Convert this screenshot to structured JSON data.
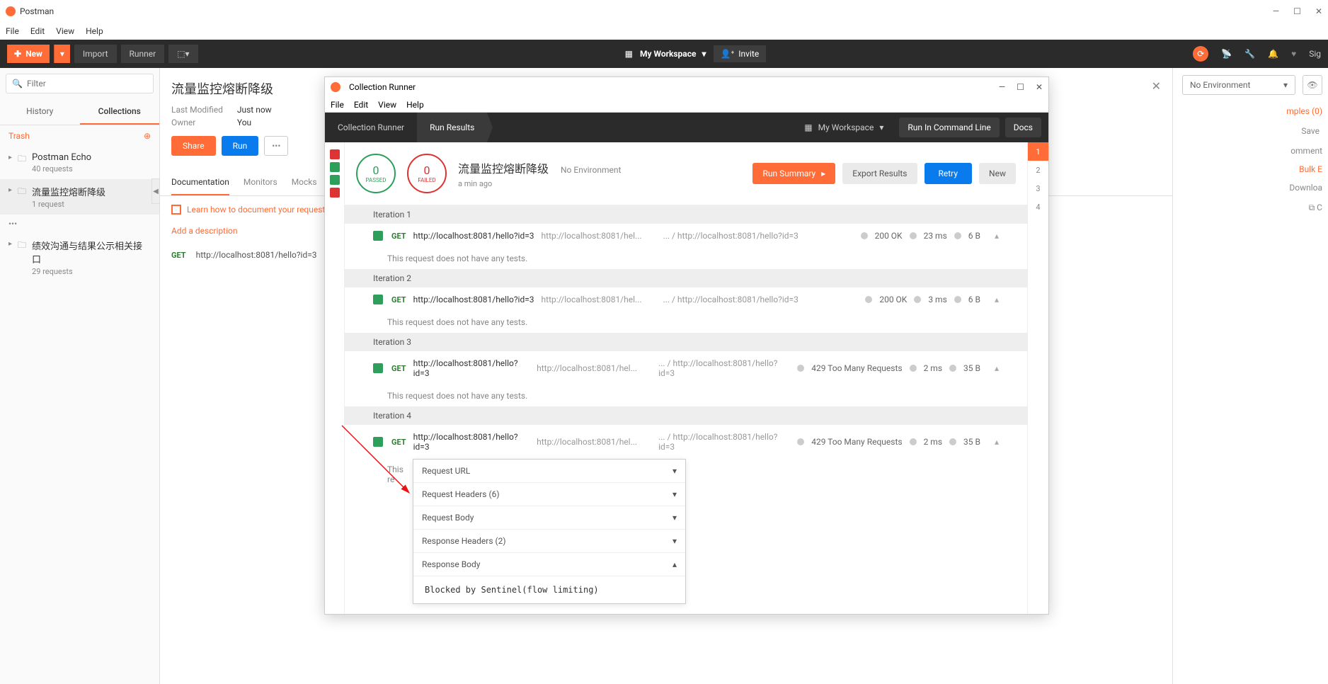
{
  "app": {
    "title": "Postman"
  },
  "menu": {
    "file": "File",
    "edit": "Edit",
    "view": "View",
    "help": "Help"
  },
  "toolbar": {
    "new": "New",
    "import": "Import",
    "runner": "Runner",
    "workspace": "My Workspace",
    "invite": "Invite",
    "signin": "Sig"
  },
  "sidebar": {
    "filter_placeholder": "Filter",
    "tab_history": "History",
    "tab_collections": "Collections",
    "trash": "Trash",
    "collections": [
      {
        "name": "Postman Echo",
        "sub": "40 requests"
      },
      {
        "name": "流量监控熔断降级",
        "sub": "1 request"
      },
      {
        "name": "绩效沟通与结果公示相关接口",
        "sub": "29 requests"
      }
    ]
  },
  "doc": {
    "title": "流量监控熔断降级",
    "last_mod_label": "Last Modified",
    "last_mod_val": "Just now",
    "owner_label": "Owner",
    "owner_val": "You",
    "share": "Share",
    "run": "Run",
    "tab_doc": "Documentation",
    "tab_mon": "Monitors",
    "tab_mock": "Mocks",
    "learn": "Learn how to document your requests",
    "add_desc": "Add a description",
    "method": "GET",
    "url": "http://localhost:8081/hello?id=3"
  },
  "env": {
    "none": "No Environment"
  },
  "rightbar": {
    "examples": "mples (0)",
    "save": "Save",
    "comments": "omment",
    "bulk": "Bulk E",
    "download": "Downloa"
  },
  "runner": {
    "title": "Collection Runner",
    "menu": {
      "file": "File",
      "edit": "Edit",
      "view": "View",
      "help": "Help"
    },
    "bc1": "Collection Runner",
    "bc2": "Run Results",
    "workspace": "My Workspace",
    "cmd": "Run In Command Line",
    "docs": "Docs",
    "passed": "0",
    "passed_lbl": "PASSED",
    "failed": "0",
    "failed_lbl": "FAILED",
    "name": "流量监控熔断降级",
    "env": "No Environment",
    "time": "a min ago",
    "btn_summary": "Run Summary",
    "btn_export": "Export Results",
    "btn_retry": "Retry",
    "btn_new": "New",
    "no_tests": "This request does not have any tests.",
    "iterations": [
      {
        "label": "Iteration 1",
        "status": "200 OK",
        "time": "23 ms",
        "size": "6 B"
      },
      {
        "label": "Iteration 2",
        "status": "200 OK",
        "time": "3 ms",
        "size": "6 B"
      },
      {
        "label": "Iteration 3",
        "status": "429 Too Many Requests",
        "time": "2 ms",
        "size": "35 B"
      },
      {
        "label": "Iteration 4",
        "status": "429 Too Many Requests",
        "time": "2 ms",
        "size": "35 B"
      }
    ],
    "req": {
      "method": "GET",
      "url": "http://localhost:8081/hello?id=3",
      "u2": "http://localhost:8081/hel...",
      "u3": "... / http://localhost:8081/hello?id=3"
    },
    "detail": {
      "req_url": "Request URL",
      "req_headers": "Request Headers   (6)",
      "req_body": "Request Body",
      "res_headers": "Response Headers   (2)",
      "res_body": "Response Body",
      "body_text": "Blocked by Sentinel(flow limiting)",
      "partial": "This re"
    },
    "pager": [
      "1",
      "2",
      "3",
      "4"
    ]
  }
}
